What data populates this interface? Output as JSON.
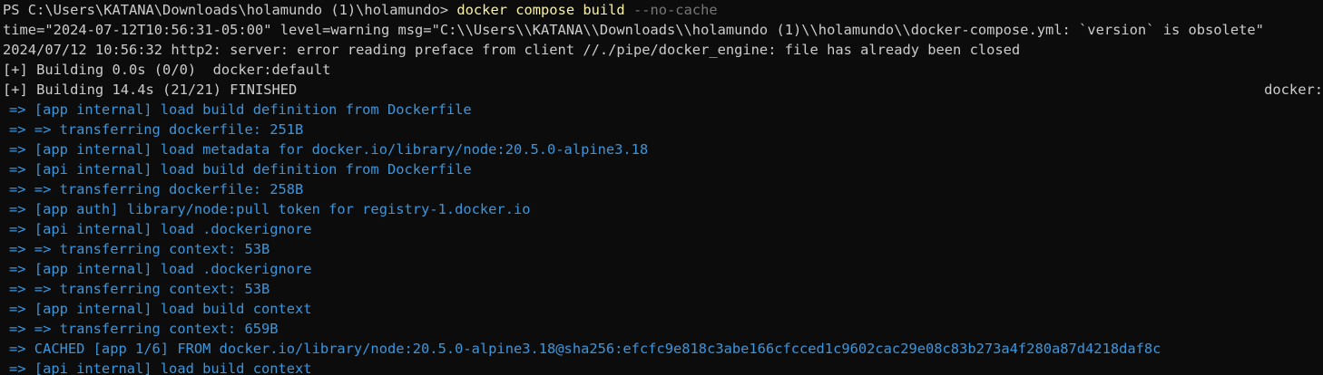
{
  "prompt": {
    "path": "PS C:\\Users\\KATANA\\Downloads\\holamundo (1)\\holamundo> ",
    "command": "docker compose build",
    "flag": " --no-cache"
  },
  "messages": [
    "time=\"2024-07-12T10:56:31-05:00\" level=warning msg=\"C:\\\\Users\\\\KATANA\\\\Downloads\\\\holamundo (1)\\\\holamundo\\\\docker-compose.yml: `version` is obsolete\"",
    "2024/07/12 10:56:32 http2: server: error reading preface from client //./pipe/docker_engine: file has already been closed",
    "[+] Building 0.0s (0/0)  docker:default"
  ],
  "build_status": {
    "text": "[+] Building 14.4s (21/21) FINISHED",
    "right": "docker:"
  },
  "steps": [
    "=> [app internal] load build definition from Dockerfile",
    "=> => transferring dockerfile: 251B",
    "=> [app internal] load metadata for docker.io/library/node:20.5.0-alpine3.18",
    "=> [api internal] load build definition from Dockerfile",
    "=> => transferring dockerfile: 258B",
    "=> [app auth] library/node:pull token for registry-1.docker.io",
    "=> [api internal] load .dockerignore",
    "=> => transferring context: 53B",
    "=> [app internal] load .dockerignore",
    "=> => transferring context: 53B",
    "=> [app internal] load build context",
    "=> => transferring context: 659B",
    "=> CACHED [app 1/6] FROM docker.io/library/node:20.5.0-alpine3.18@sha256:efcfc9e818c3abe166cfcced1c9602cac29e08c83b273a4f280a87d4218daf8c",
    "=> [api internal] load build context"
  ],
  "colors": {
    "background": "#0c0c0c",
    "text": "#cccccc",
    "command": "#f9f1a5",
    "flag": "#767676",
    "step": "#3a96dd"
  }
}
